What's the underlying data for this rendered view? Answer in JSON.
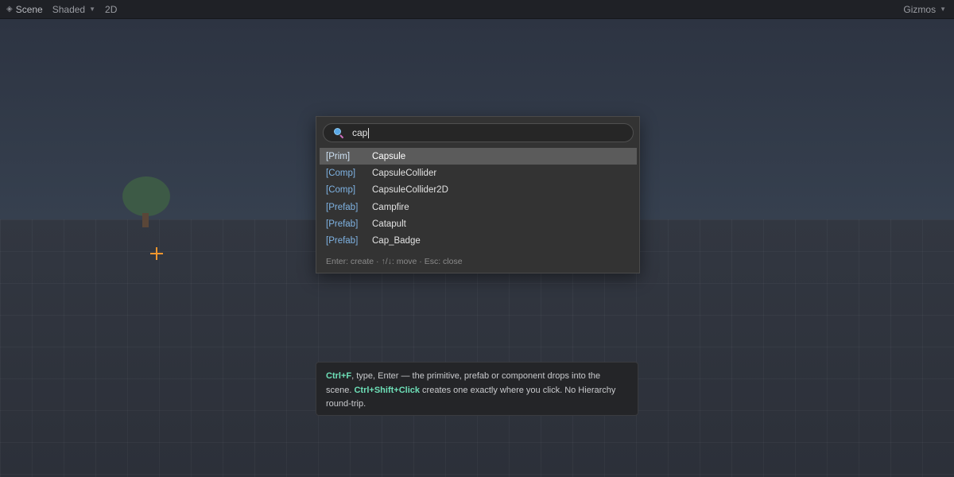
{
  "toolbar": {
    "scene_label": "Scene",
    "scene_icon": "scene-icon",
    "shading_label": "Shaded",
    "mode_2d_label": "2D",
    "gizmos_label": "Gizmos"
  },
  "search": {
    "value": "cap",
    "icon": "search-icon"
  },
  "results": [
    {
      "tag": "[Prim]",
      "name": "Capsule",
      "selected": true
    },
    {
      "tag": "[Comp]",
      "name": "CapsuleCollider",
      "selected": false
    },
    {
      "tag": "[Comp]",
      "name": "CapsuleCollider2D",
      "selected": false
    },
    {
      "tag": "[Prefab]",
      "name": "Campfire",
      "selected": false
    },
    {
      "tag": "[Prefab]",
      "name": "Catapult",
      "selected": false
    },
    {
      "tag": "[Prefab]",
      "name": "Cap_Badge",
      "selected": false
    }
  ],
  "hint": "Enter: create  ·  ↑/↓: move  ·  Esc: close",
  "info": {
    "key1": "Ctrl+F",
    "text1": ", type, Enter — the primitive, prefab or component drops into the scene. ",
    "key2": "Ctrl+Shift+Click",
    "text2": " creates one exactly where you click. No Hierarchy round-trip."
  },
  "colors": {
    "accent_key": "#6ee0b8",
    "tag_color": "#7fb3e3",
    "pivot": "#f0962e",
    "selected_row": "#5b5b5b"
  }
}
